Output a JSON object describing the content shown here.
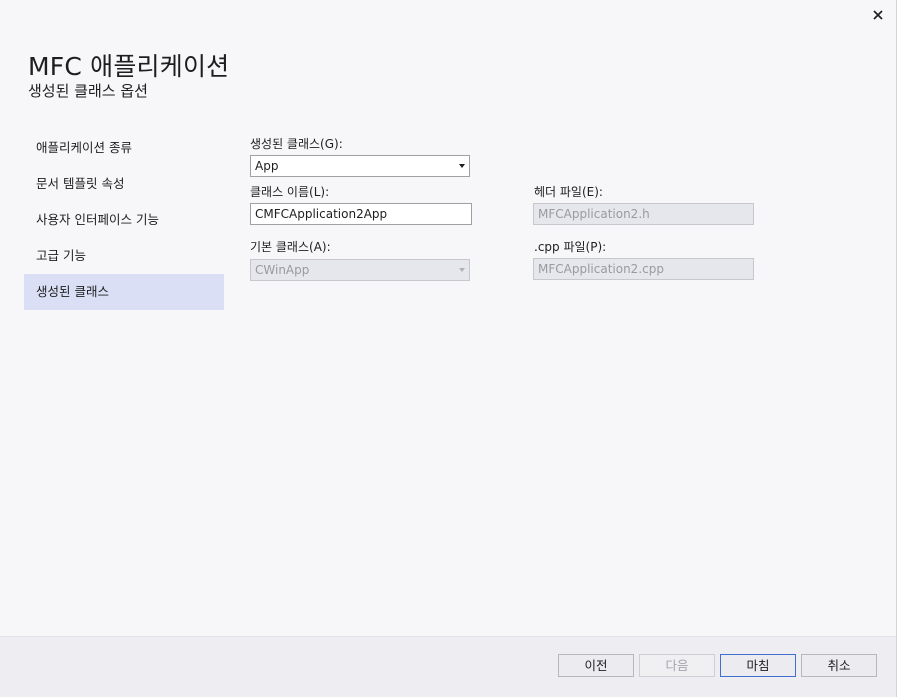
{
  "header": {
    "title": "MFC 애플리케이션",
    "subtitle": "생성된 클래스 옵션"
  },
  "icons": {
    "close": "close-icon"
  },
  "sidebar": {
    "items": [
      {
        "label": "애플리케이션 종류",
        "selected": false
      },
      {
        "label": "문서 템플릿 속성",
        "selected": false
      },
      {
        "label": "사용자 인터페이스 기능",
        "selected": false
      },
      {
        "label": "고급 기능",
        "selected": false
      },
      {
        "label": "생성된 클래스",
        "selected": true
      }
    ]
  },
  "form": {
    "generated_classes": {
      "label": "생성된 클래스(G):",
      "value": "App"
    },
    "class_name": {
      "label": "클래스 이름(L):",
      "value": "CMFCApplication2App"
    },
    "base_class": {
      "label": "기본 클래스(A):",
      "value": "CWinApp"
    },
    "header_file": {
      "label": "헤더 파일(E):",
      "value": "MFCApplication2.h"
    },
    "cpp_file": {
      "label": ".cpp 파일(P):",
      "value": "MFCApplication2.cpp"
    }
  },
  "footer": {
    "prev_label": "이전",
    "next_label": "다음",
    "finish_label": "마침",
    "cancel_label": "취소"
  },
  "colors": {
    "selected_nav": "#dadff6",
    "primary_border": "#3f6fd1",
    "background": "#f7f7f9"
  }
}
